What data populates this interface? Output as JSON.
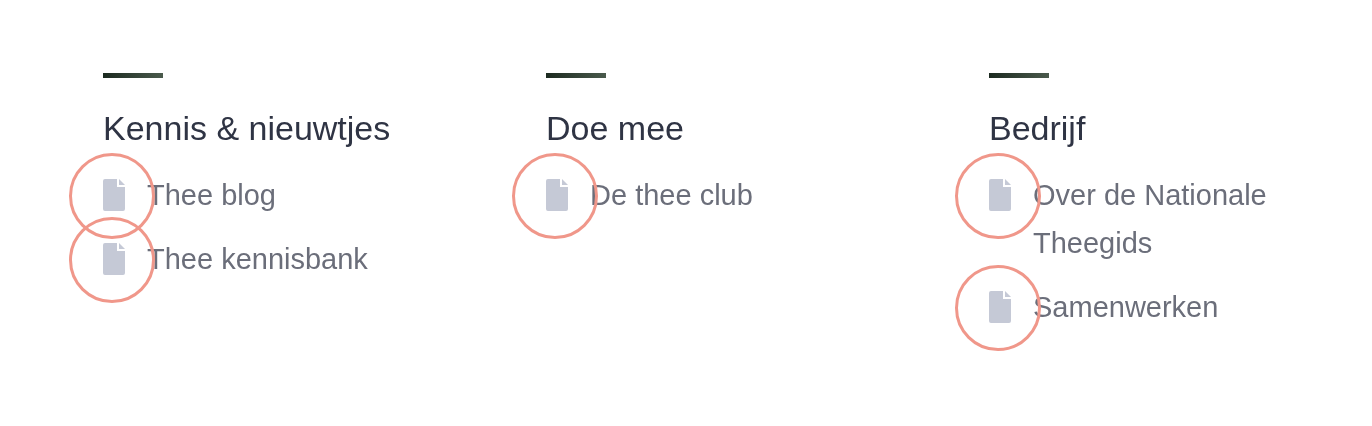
{
  "columns": [
    {
      "heading": "Kennis & nieuwtjes",
      "links": [
        {
          "label": "Thee blog",
          "highlighted": true
        },
        {
          "label": "Thee kennisbank",
          "highlighted": true
        }
      ]
    },
    {
      "heading": "Doe mee",
      "links": [
        {
          "label": "De thee club",
          "highlighted": true
        }
      ]
    },
    {
      "heading": "Bedrijf",
      "links": [
        {
          "label": "Over de Nationale Theegids",
          "highlighted": true
        },
        {
          "label": "Samenwerken",
          "highlighted": true
        }
      ]
    }
  ]
}
